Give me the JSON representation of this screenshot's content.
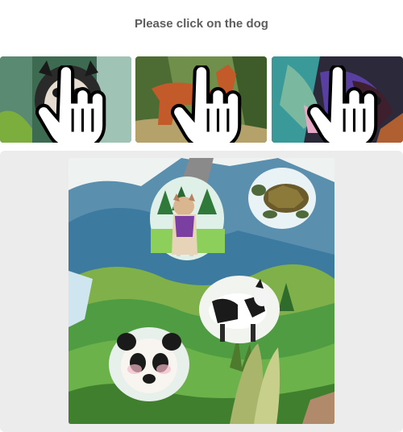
{
  "prompt": {
    "text": "Please click on the dog"
  },
  "examples": [
    {
      "subject": "dog-watercolor-1",
      "icon": "hand-pointer-icon"
    },
    {
      "subject": "dog-watercolor-2",
      "icon": "hand-pointer-icon"
    },
    {
      "subject": "dog-watercolor-3",
      "icon": "hand-pointer-icon"
    }
  ],
  "scene": {
    "style": "watercolor-landscape",
    "objects": [
      "dog",
      "turtle",
      "cow",
      "panda"
    ]
  },
  "colors": {
    "title": "#5d5d5d",
    "panel_background": "#ececec",
    "page_background": "#ffffff"
  }
}
